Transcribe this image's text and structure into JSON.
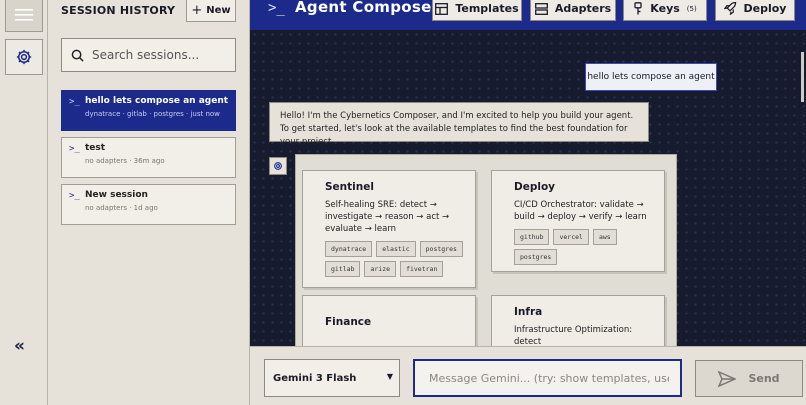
{
  "rail": {
    "menu_icon": "menu-icon",
    "settings_icon": "gear-icon",
    "collapse_glyph": "«"
  },
  "sidebar": {
    "title": "SESSION HISTORY",
    "new_button": "New",
    "search_placeholder": "Search sessions...",
    "sessions": [
      {
        "title": "hello lets compose an agent",
        "meta": "dynatrace · gitlab · postgres · just now",
        "active": true
      },
      {
        "title": "test",
        "meta": "no adapters · 36m ago",
        "active": false
      },
      {
        "title": "New session",
        "meta": "no adapters · 1d ago",
        "active": false
      }
    ]
  },
  "header": {
    "logo": ">_",
    "title": "Agent Composer",
    "buttons": {
      "templates": "Templates",
      "adapters": "Adapters",
      "keys": "Keys",
      "keys_count": "(5)",
      "deploy": "Deploy"
    }
  },
  "chat": {
    "user_message": "hello lets compose an agent",
    "bot_message": "Hello! I'm the Cybernetics Composer, and I'm excited to help you build your agent. To get started, let's look at the available templates to find the best foundation for your project.",
    "templates": [
      {
        "name": "Sentinel",
        "desc": "Self-healing SRE: detect → investigate → reason → act → evaluate → learn",
        "tags": [
          "dynatrace",
          "elastic",
          "postgres",
          "gitlab",
          "arize",
          "fivetran"
        ]
      },
      {
        "name": "Deploy",
        "desc": "CI/CD Orchestrator: validate → build → deploy → verify → learn",
        "tags": [
          "github",
          "vercel",
          "aws",
          "postgres"
        ]
      },
      {
        "name": "Finance",
        "desc": "",
        "tags": []
      },
      {
        "name": "Infra",
        "desc": "Infrastructure Optimization: detect",
        "tags": []
      }
    ]
  },
  "composer": {
    "model": "Gemini 3 Flash",
    "input_placeholder": "Message Gemini... (try: show templates, use sla",
    "send": "Send"
  },
  "colors": {
    "brand_navy": "#1c2a8c",
    "chat_bg": "#161b2e",
    "panel_beige": "#e6e2da"
  }
}
